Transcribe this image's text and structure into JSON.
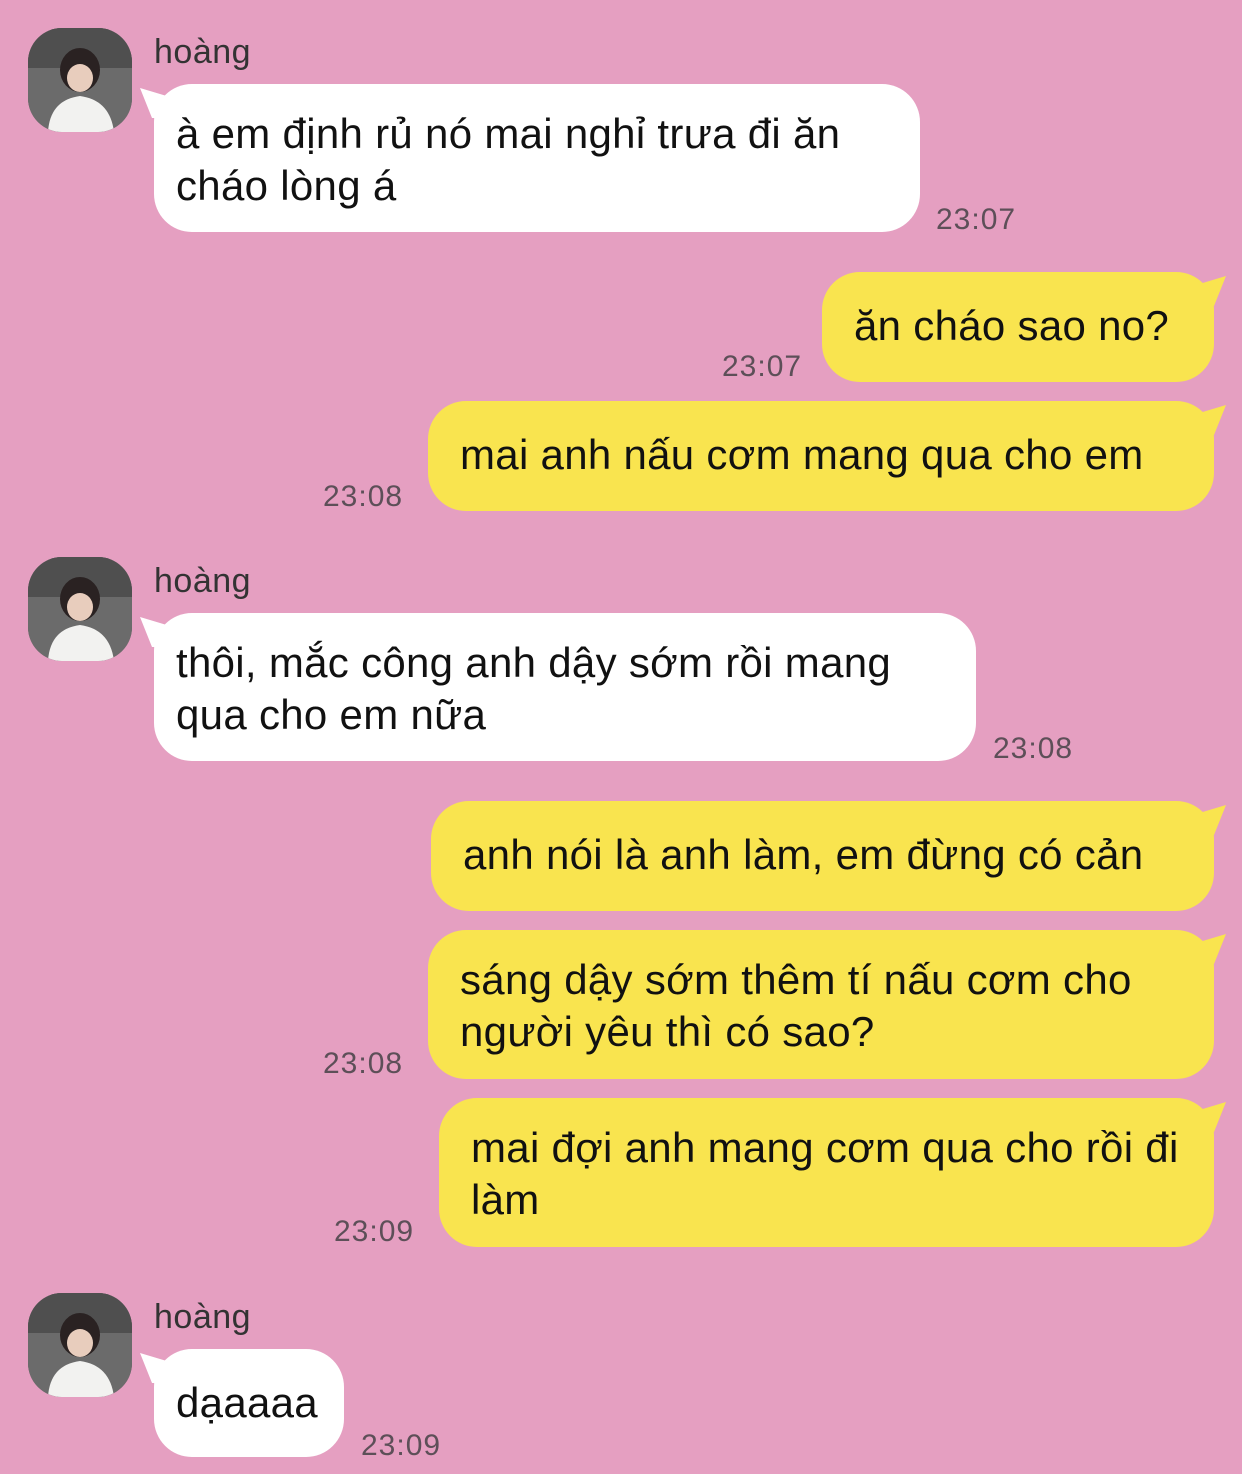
{
  "contact": {
    "name": "hoàng"
  },
  "messages": [
    {
      "from": "hoàng",
      "text": "à em định rủ nó mai nghỉ trưa đi ăn cháo lòng á",
      "time": "23:07"
    },
    {
      "from": "me",
      "text": "ăn cháo sao no?",
      "time": "23:07"
    },
    {
      "from": "me",
      "text": "mai anh nấu cơm mang qua cho em",
      "time": "23:08"
    },
    {
      "from": "hoàng",
      "text": "thôi, mắc công anh dậy sớm rồi mang qua cho em nữa",
      "time": "23:08"
    },
    {
      "from": "me",
      "text": "anh nói là anh làm, em đừng có cản",
      "time": ""
    },
    {
      "from": "me",
      "text": "sáng dậy sớm thêm tí nấu cơm cho người yêu thì có sao?",
      "time": "23:08"
    },
    {
      "from": "me",
      "text": "mai đợi anh mang cơm qua cho rồi đi làm",
      "time": "23:09"
    },
    {
      "from": "hoàng",
      "text": "dạaaaa",
      "time": "23:09"
    }
  ],
  "colors": {
    "background": "#e59fc1",
    "incoming": "#ffffff",
    "outgoing": "#f9e44f"
  },
  "icons": {
    "avatar": "profile-photo"
  }
}
